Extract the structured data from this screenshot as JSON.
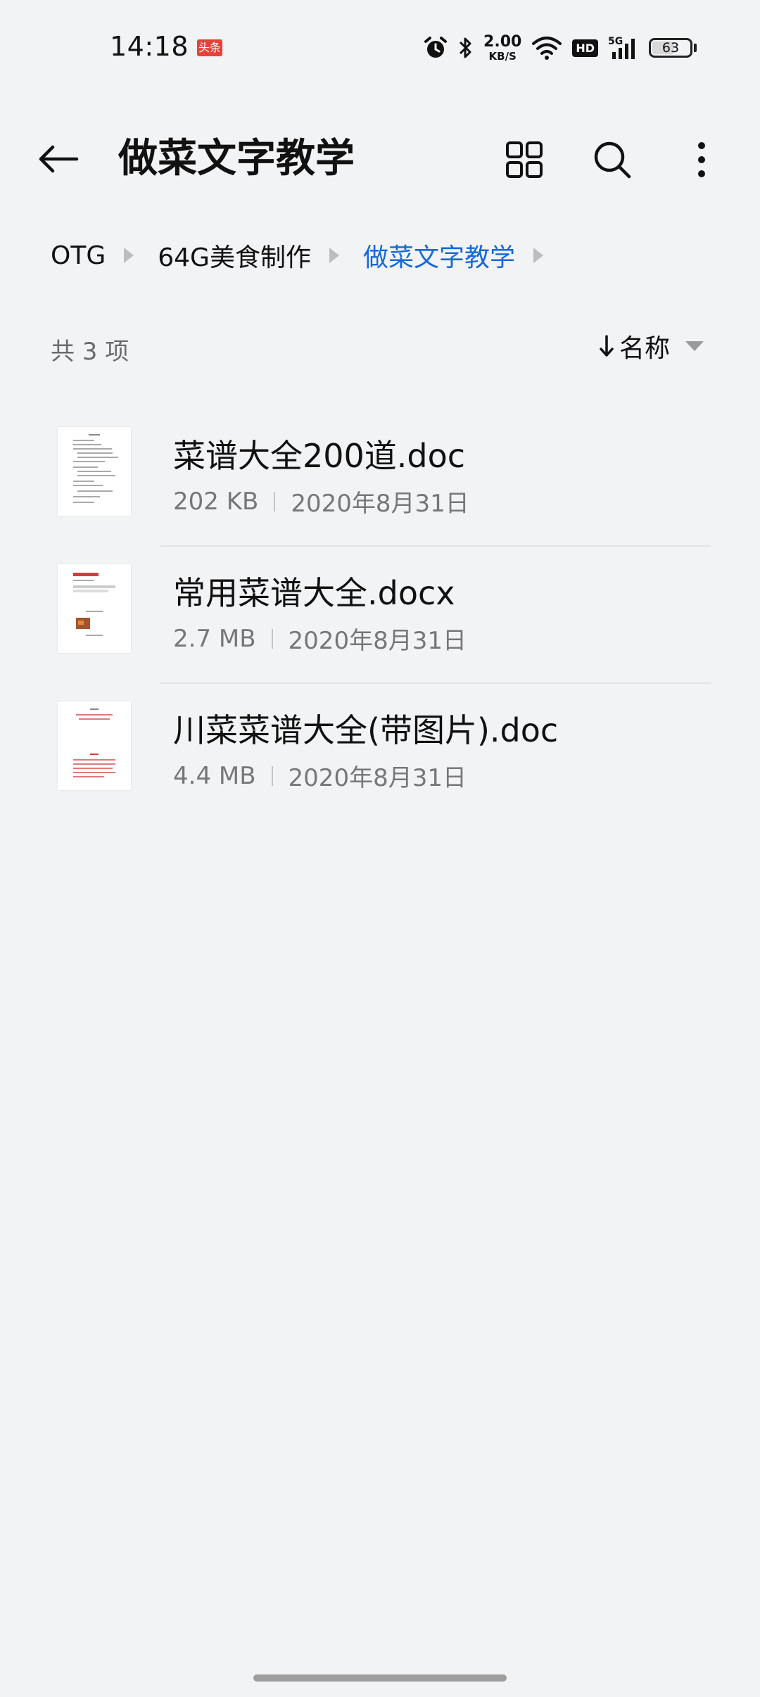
{
  "status_bar": {
    "time": "14:18",
    "app_badge": "头条",
    "net_speed_value": "2.00",
    "net_speed_unit": "KB/S",
    "hd_label": "HD",
    "network_label": "5G",
    "battery_level": "63",
    "battery_fraction": 0.63
  },
  "header": {
    "title": "做菜文字教学",
    "actions": [
      "grid-view-icon",
      "search-icon",
      "more-vert-icon"
    ]
  },
  "breadcrumb": {
    "items": [
      "OTG",
      "64G美食制作",
      "做菜文字教学"
    ],
    "active_index": 2
  },
  "list_info": {
    "count_label": "共 3 项",
    "sort_label": "名称"
  },
  "files": [
    {
      "name": "菜谱大全200道.doc",
      "size": "202 KB",
      "date": "2020年8月31日"
    },
    {
      "name": "常用菜谱大全.docx",
      "size": "2.7 MB",
      "date": "2020年8月31日"
    },
    {
      "name": "川菜菜谱大全(带图片).doc",
      "size": "4.4 MB",
      "date": "2020年8月31日"
    }
  ],
  "colors": {
    "accent": "#1669d8",
    "background": "#f2f3f5",
    "badge_red": "#e8413a",
    "text_primary": "#111111",
    "text_secondary": "#777777"
  }
}
